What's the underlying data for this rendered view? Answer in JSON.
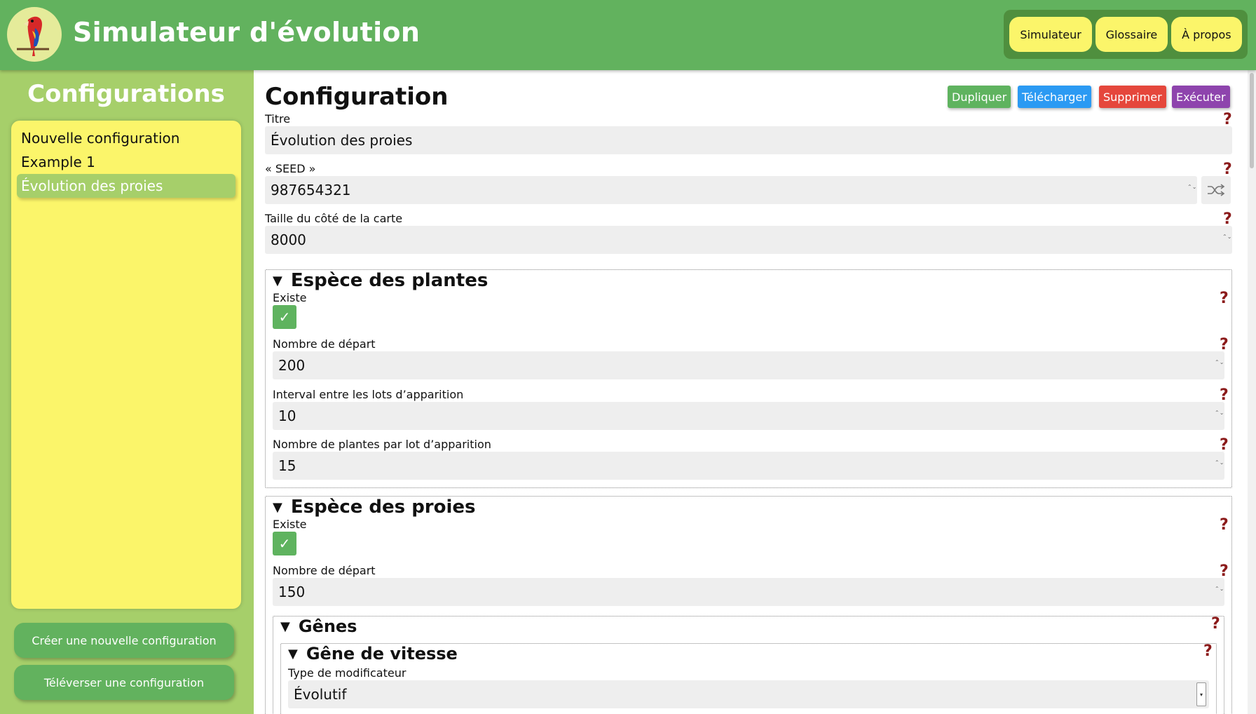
{
  "app": {
    "title": "Simulateur d'évolution"
  },
  "nav": {
    "items": [
      "Simulateur",
      "Glossaire",
      "À propos"
    ]
  },
  "sidebar": {
    "title": "Configurations",
    "items": [
      "Nouvelle configuration",
      "Example 1",
      "Évolution des proies"
    ],
    "active_item": "Évolution des proies",
    "create_button": "Créer une nouvelle configuration",
    "upload_button": "Téléverser une configuration"
  },
  "main": {
    "title": "Configuration",
    "actions": {
      "duplicate": "Dupliquer",
      "download": "Télécharger",
      "delete": "Supprimer",
      "execute": "Exécuter"
    },
    "help_glyph": "?",
    "spin_glyph": "⌃⌄",
    "fields": {
      "title": {
        "label": "Titre",
        "value": "Évolution des proies"
      },
      "seed": {
        "label": "« SEED »",
        "value": "987654321"
      },
      "map_size": {
        "label": "Taille du côté de la carte",
        "value": "8000"
      }
    },
    "plants": {
      "heading": "Espèce des plantes",
      "exists_label": "Existe",
      "start_count_label": "Nombre de départ",
      "start_count": "200",
      "interval_label": "Interval entre les lots d’apparition",
      "interval": "10",
      "per_batch_label": "Nombre de plantes par lot d’apparition",
      "per_batch": "15"
    },
    "prey": {
      "heading": "Espèce des proies",
      "exists_label": "Existe",
      "start_count_label": "Nombre de départ",
      "start_count": "150",
      "genes": {
        "heading": "Gênes",
        "speed": {
          "heading": "Gêne de vitesse",
          "modifier_label": "Type de modificateur",
          "modifier_value": "Évolutif"
        }
      }
    }
  },
  "colors": {
    "header_green": "#62b25e",
    "sidebar_green": "#a6cf6a",
    "nav_yellow": "#fbf56a",
    "duplicate": "#5fb35f",
    "download": "#2b9af3",
    "delete": "#e5473c",
    "execute": "#8e44ad",
    "help": "#8b1a1a"
  },
  "icons": {
    "logo": "parrot-logo",
    "help": "question-mark-icon",
    "shuffle": "shuffle-icon",
    "check": "checkmark-icon",
    "collapse": "triangle-down-icon"
  }
}
